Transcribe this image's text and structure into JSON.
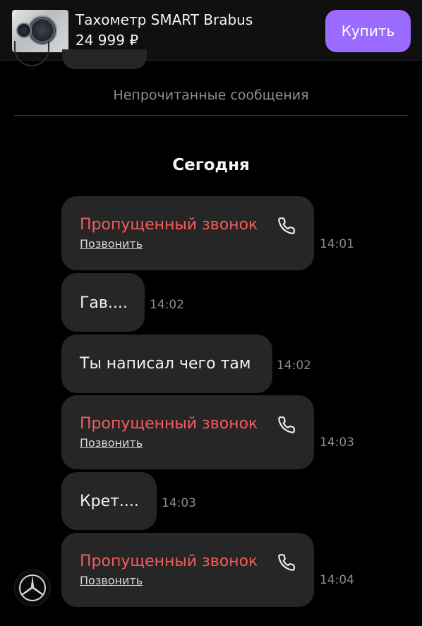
{
  "product": {
    "title": "Тахометр SMART Brabus",
    "price": "24 999 ₽",
    "buy_label": "Купить"
  },
  "chat": {
    "unread_label": "Непрочитанные сообщения",
    "date_header": "Сегодня",
    "messages": [
      {
        "type": "missed_call",
        "title": "Пропущенный звонок",
        "action": "Позвонить",
        "time": "14:01"
      },
      {
        "type": "text",
        "text": "Гав....",
        "time": "14:02"
      },
      {
        "type": "text",
        "text": "Ты написал чего там",
        "time": "14:02"
      },
      {
        "type": "missed_call",
        "title": "Пропущенный звонок",
        "action": "Позвонить",
        "time": "14:03"
      },
      {
        "type": "text",
        "text": "Крет....",
        "time": "14:03"
      },
      {
        "type": "missed_call",
        "title": "Пропущенный звонок",
        "action": "Позвонить",
        "time": "14:04"
      }
    ]
  },
  "icons": {
    "phone": "phone-icon",
    "avatar": "mercedes-logo-icon"
  },
  "colors": {
    "accent": "#9b6bff",
    "missed_call": "#f25c5c",
    "bubble": "#262626",
    "background": "#000000"
  }
}
